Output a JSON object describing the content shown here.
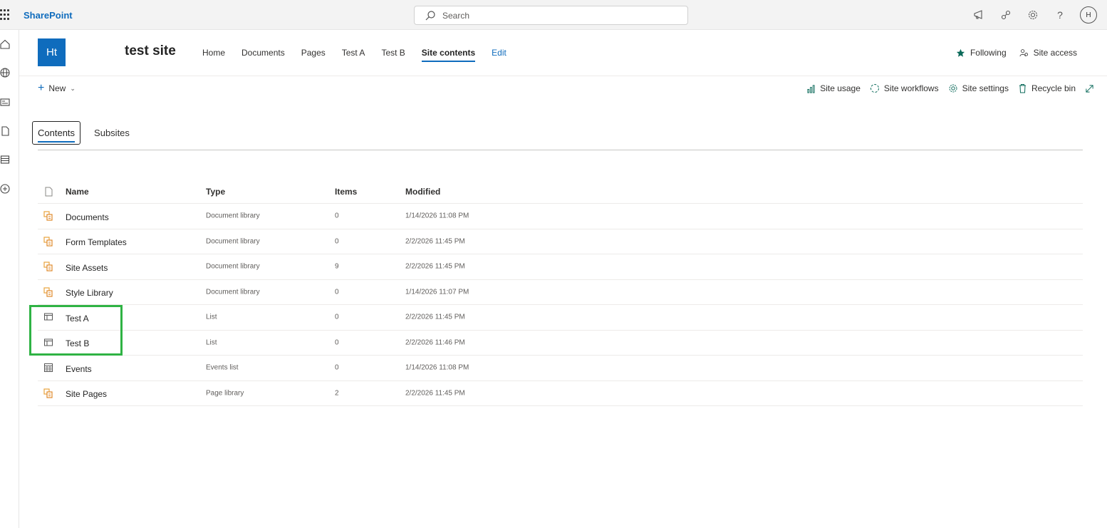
{
  "suite": {
    "brand": "SharePoint",
    "search_placeholder": "Search",
    "avatar_initial": "H",
    "help_glyph": "?"
  },
  "site": {
    "logo_text": "Ht",
    "title": "test site",
    "nav": [
      {
        "label": "Home"
      },
      {
        "label": "Documents"
      },
      {
        "label": "Pages"
      },
      {
        "label": "Test A"
      },
      {
        "label": "Test B"
      },
      {
        "label": "Site contents",
        "active": true
      },
      {
        "label": "Edit"
      }
    ],
    "following_label": "Following",
    "site_access_label": "Site access"
  },
  "commandbar": {
    "new_label": "New",
    "actions": [
      {
        "label": "Site usage",
        "icon": "chart-icon"
      },
      {
        "label": "Site workflows",
        "icon": "workflow-icon"
      },
      {
        "label": "Site settings",
        "icon": "gear-icon"
      },
      {
        "label": "Recycle bin",
        "icon": "trash-icon"
      }
    ]
  },
  "tabs": {
    "contents": "Contents",
    "subsites": "Subsites"
  },
  "table": {
    "columns": {
      "name": "Name",
      "type": "Type",
      "items": "Items",
      "modified": "Modified"
    },
    "rows": [
      {
        "name": "Documents",
        "type": "Document library",
        "items": "0",
        "modified": "1/14/2026 11:08 PM",
        "icon": "library-icon"
      },
      {
        "name": "Form Templates",
        "type": "Document library",
        "items": "0",
        "modified": "2/2/2026 11:45 PM",
        "icon": "library-icon"
      },
      {
        "name": "Site Assets",
        "type": "Document library",
        "items": "9",
        "modified": "2/2/2026 11:45 PM",
        "icon": "library-icon"
      },
      {
        "name": "Style Library",
        "type": "Document library",
        "items": "0",
        "modified": "1/14/2026 11:07 PM",
        "icon": "library-icon"
      },
      {
        "name": "Test A",
        "type": "List",
        "items": "0",
        "modified": "2/2/2026 11:45 PM",
        "icon": "list-icon"
      },
      {
        "name": "Test B",
        "type": "List",
        "items": "0",
        "modified": "2/2/2026 11:46 PM",
        "icon": "list-icon"
      },
      {
        "name": "Events",
        "type": "Events list",
        "items": "0",
        "modified": "1/14/2026 11:08 PM",
        "icon": "calendar-icon"
      },
      {
        "name": "Site Pages",
        "type": "Page library",
        "items": "2",
        "modified": "2/2/2026 11:45 PM",
        "icon": "library-icon"
      }
    ]
  },
  "colors": {
    "accent": "#0f6cbd",
    "highlight": "#2fb344",
    "library_icon": "#e8a33d"
  }
}
